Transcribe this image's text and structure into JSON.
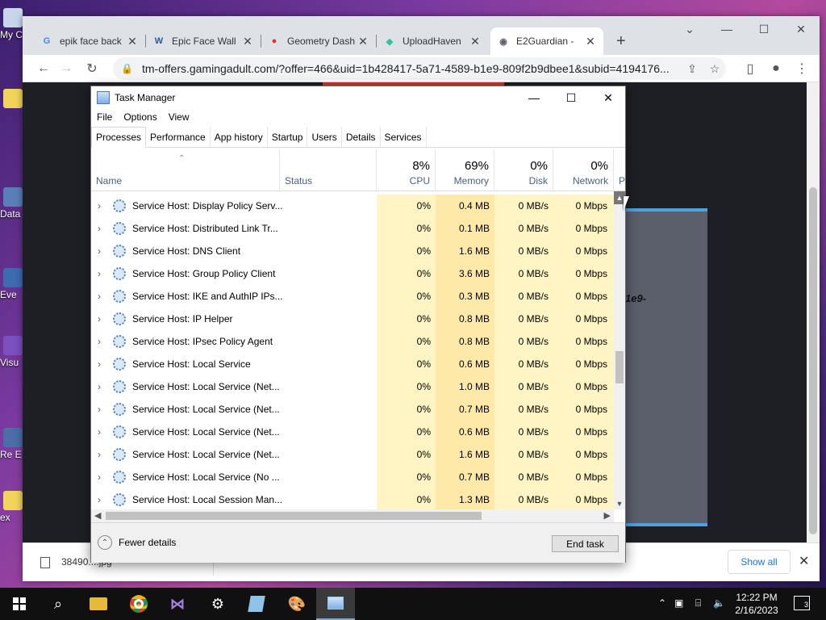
{
  "desktop": {
    "icons": [
      {
        "label": "My C",
        "top": 0
      },
      {
        "label": "Data",
        "top": 0
      },
      {
        "label": "Eve",
        "top": 0
      },
      {
        "label": "Visu",
        "top": 0
      },
      {
        "label": "Re E",
        "top": 0
      },
      {
        "label": "ex",
        "top": 0
      }
    ]
  },
  "browser": {
    "tabs": [
      {
        "title": "epik face back",
        "icon": "google-icon",
        "icon_color": "#4285f4"
      },
      {
        "title": "Epic Face Wall",
        "icon": "word-icon",
        "icon_color": "#2b5797"
      },
      {
        "title": "Geometry Dash",
        "icon": "geometry-dash-icon",
        "icon_color": "#e52d27"
      },
      {
        "title": "UploadHaven",
        "icon": "uploadhaven-icon",
        "icon_color": "#2ec4a0"
      },
      {
        "title": "E2Guardian - ",
        "icon": "globe-icon",
        "icon_color": "#5f6368",
        "active": true
      }
    ],
    "new_tab_label": "+",
    "url": "tm-offers.gamingadult.com/?offer=466&uid=1b428417-5a71-4589-b1e9-809f2b9dbee1&subid=4194176...",
    "page_fragment": "1e9-",
    "download": {
      "filename": "38490....jpg",
      "show_all_label": "Show all"
    }
  },
  "task_manager": {
    "title": "Task Manager",
    "menu": [
      "File",
      "Options",
      "View"
    ],
    "tabs": [
      "Processes",
      "Performance",
      "App history",
      "Startup",
      "Users",
      "Details",
      "Services"
    ],
    "active_tab": "Processes",
    "columns": {
      "name": "Name",
      "status": "Status",
      "cpu": {
        "pct": "8%",
        "label": "CPU"
      },
      "memory": {
        "pct": "69%",
        "label": "Memory"
      },
      "disk": {
        "pct": "0%",
        "label": "Disk"
      },
      "network": {
        "pct": "0%",
        "label": "Network"
      },
      "power": "P"
    },
    "processes": [
      {
        "name": "Service Host: Display Policy Serv...",
        "cpu": "0%",
        "memory": "0.4 MB",
        "disk": "0 MB/s",
        "network": "0 Mbps"
      },
      {
        "name": "Service Host: Distributed Link Tr...",
        "cpu": "0%",
        "memory": "0.1 MB",
        "disk": "0 MB/s",
        "network": "0 Mbps"
      },
      {
        "name": "Service Host: DNS Client",
        "cpu": "0%",
        "memory": "1.6 MB",
        "disk": "0 MB/s",
        "network": "0 Mbps"
      },
      {
        "name": "Service Host: Group Policy Client",
        "cpu": "0%",
        "memory": "3.6 MB",
        "disk": "0 MB/s",
        "network": "0 Mbps"
      },
      {
        "name": "Service Host: IKE and AuthIP IPs...",
        "cpu": "0%",
        "memory": "0.3 MB",
        "disk": "0 MB/s",
        "network": "0 Mbps"
      },
      {
        "name": "Service Host: IP Helper",
        "cpu": "0%",
        "memory": "0.8 MB",
        "disk": "0 MB/s",
        "network": "0 Mbps"
      },
      {
        "name": "Service Host: IPsec Policy Agent",
        "cpu": "0%",
        "memory": "0.8 MB",
        "disk": "0 MB/s",
        "network": "0 Mbps"
      },
      {
        "name": "Service Host: Local Service",
        "cpu": "0%",
        "memory": "0.6 MB",
        "disk": "0 MB/s",
        "network": "0 Mbps"
      },
      {
        "name": "Service Host: Local Service (Net...",
        "cpu": "0%",
        "memory": "1.0 MB",
        "disk": "0 MB/s",
        "network": "0 Mbps"
      },
      {
        "name": "Service Host: Local Service (Net...",
        "cpu": "0%",
        "memory": "0.7 MB",
        "disk": "0 MB/s",
        "network": "0 Mbps"
      },
      {
        "name": "Service Host: Local Service (Net...",
        "cpu": "0%",
        "memory": "0.6 MB",
        "disk": "0 MB/s",
        "network": "0 Mbps"
      },
      {
        "name": "Service Host: Local Service (Net...",
        "cpu": "0%",
        "memory": "1.6 MB",
        "disk": "0 MB/s",
        "network": "0 Mbps"
      },
      {
        "name": "Service Host: Local Service (No ...",
        "cpu": "0%",
        "memory": "0.7 MB",
        "disk": "0 MB/s",
        "network": "0 Mbps"
      },
      {
        "name": "Service Host: Local Session Man...",
        "cpu": "0%",
        "memory": "1.3 MB",
        "disk": "0 MB/s",
        "network": "0 Mbps"
      }
    ],
    "footer": {
      "fewer_details": "Fewer details",
      "end_task": "End task"
    }
  },
  "taskbar": {
    "apps": [
      "start-icon",
      "search-icon",
      "file-explorer-icon",
      "chrome-icon",
      "visual-studio-icon",
      "settings-icon",
      "notepad-icon",
      "paint-icon",
      "task-manager-icon"
    ],
    "clock_time": "12:22 PM",
    "clock_date": "2/16/2023",
    "notifications": "3"
  }
}
